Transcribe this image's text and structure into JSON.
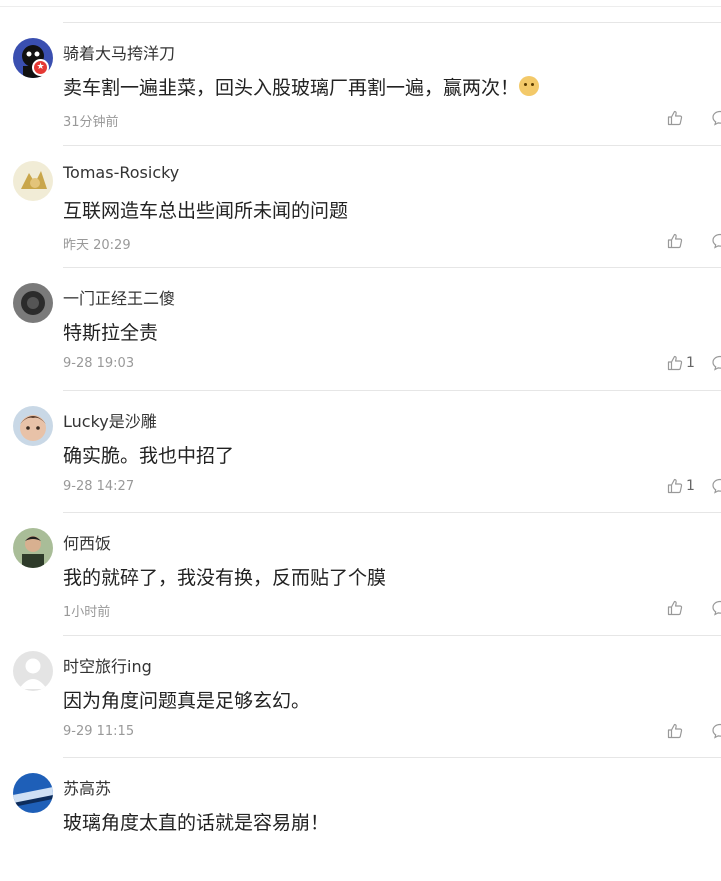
{
  "comments": [
    {
      "username": "骑着大马挎洋刀",
      "content": "卖车割一遍韭菜，回头入股玻璃厂再割一遍，赢两次！",
      "emoji": "doge-emoji",
      "time": "31分钟前",
      "likes": "",
      "avatar": {
        "bg": "#3a4fb0",
        "fg": "#111111",
        "badge": true
      }
    },
    {
      "username": "Tomas-Rosicky",
      "content": "互联网造车总出些闻所未闻的问题",
      "time": "昨天 20:29",
      "likes": "",
      "avatar": {
        "bg": "#e8e2c8",
        "fg": "#c9a64a"
      }
    },
    {
      "username": "一门正经王二傻",
      "content": "特斯拉全责",
      "time": "9-28 19:03",
      "likes": "1",
      "avatar": {
        "bg": "#6b6b6b",
        "fg": "#2b2b2b"
      }
    },
    {
      "username": "Lucky是沙雕",
      "content": "确实脆。我也中招了",
      "time": "9-28 14:27",
      "likes": "1",
      "avatar": {
        "bg": "#d9b6a0",
        "fg": "#7a5a48"
      }
    },
    {
      "username": "何西饭",
      "content": "我的就碎了，我没有换，反而贴了个膜",
      "time": "1小时前",
      "likes": "",
      "avatar": {
        "bg": "#9bb08a",
        "fg": "#2e3b2a"
      }
    },
    {
      "username": "时空旅行ing",
      "content": "因为角度问题真是足够玄幻。",
      "time": "9-29 11:15",
      "likes": "",
      "avatar": {
        "bg": "#e4e4e4",
        "fg": "#ffffff"
      }
    },
    {
      "username": "苏高苏",
      "content": "玻璃角度太直的话就是容易崩！",
      "time": "",
      "likes": "",
      "avatar": {
        "bg": "#1e5fb8",
        "fg": "#cfe0f5"
      }
    }
  ],
  "colors": {
    "divider": "#e6e6e6",
    "username": "#333333",
    "content": "#222222",
    "time": "#999999",
    "badge": "#e53935"
  }
}
